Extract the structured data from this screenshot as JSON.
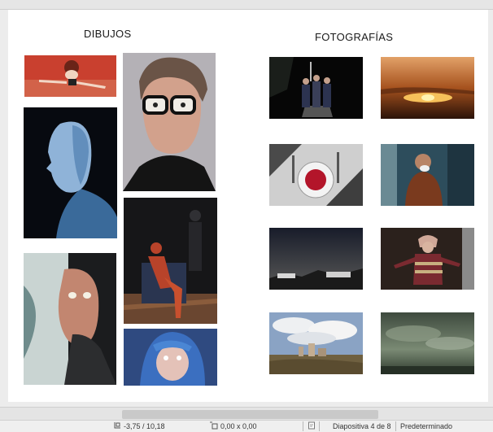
{
  "slide": {
    "left_title": "DIBUJOS",
    "right_title": "FOTOGRAFÍAS",
    "drawings": [
      {
        "name": "flying-girl-drawing"
      },
      {
        "name": "bald-profile-drawing"
      },
      {
        "name": "old-man-drawing"
      },
      {
        "name": "man-with-glasses-drawing"
      },
      {
        "name": "seated-figure-drawing"
      },
      {
        "name": "blue-hair-girl-drawing"
      }
    ],
    "photos": [
      {
        "name": "three-people-night-photo"
      },
      {
        "name": "sunset-photo"
      },
      {
        "name": "plate-shadow-photo"
      },
      {
        "name": "man-on-phone-photo"
      },
      {
        "name": "houses-dusk-photo"
      },
      {
        "name": "child-in-hat-photo"
      },
      {
        "name": "city-clouds-photo"
      },
      {
        "name": "stormy-sky-photo"
      }
    ]
  },
  "status": {
    "position": "-3,75 / 10,18",
    "size": "0,00 x 0,00",
    "slide_indicator": "Diapositiva 4 de 8",
    "layout": "Predeterminado"
  }
}
